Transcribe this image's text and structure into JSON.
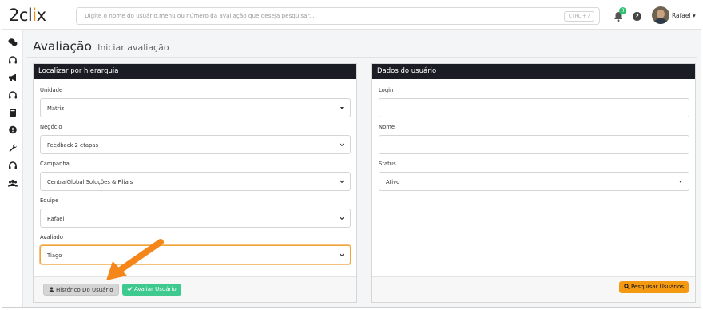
{
  "app": {
    "logo_text_pre": "2cl",
    "logo_text_x": "i",
    "logo_text_post": "x",
    "search_placeholder": "Digite o nome do usuário,menu ou número da avaliação que deseja pesquisar...",
    "search_shortcut": "CTRL + /",
    "notifications_count": "0",
    "help_label": "?",
    "user_name": "Rafael ▾",
    "accent_color": "#f39a12"
  },
  "sidebar": {
    "icons": [
      "chat-icon",
      "headset-icon",
      "megaphone-icon",
      "headset-icon",
      "book-icon",
      "comment-alert-icon",
      "wrench-icon",
      "headset-icon",
      "users-icon"
    ]
  },
  "page": {
    "title": "Avaliação",
    "subtitle": "Iniciar avaliação"
  },
  "hierarchy": {
    "header": "Localizar por hierarquia",
    "fields": [
      {
        "label": "Unidade",
        "value": "Matriz"
      },
      {
        "label": "Negócio",
        "value": "Feedback 2 etapas"
      },
      {
        "label": "Campanha",
        "value": "CentralGlobal Soluções & Filiais"
      },
      {
        "label": "Equipe",
        "value": "Rafael"
      },
      {
        "label": "Avaliado",
        "value": "Tiago"
      }
    ],
    "history_button": "Histórico Do Usuário",
    "evaluate_button": "Avaliar Usuário"
  },
  "user_data": {
    "header": "Dados do usuário",
    "login_label": "Login",
    "login_value": "",
    "name_label": "Nome",
    "name_value": "",
    "status_label": "Status",
    "status_value": "Ativo",
    "search_button": "Pesquisar Usuários"
  }
}
